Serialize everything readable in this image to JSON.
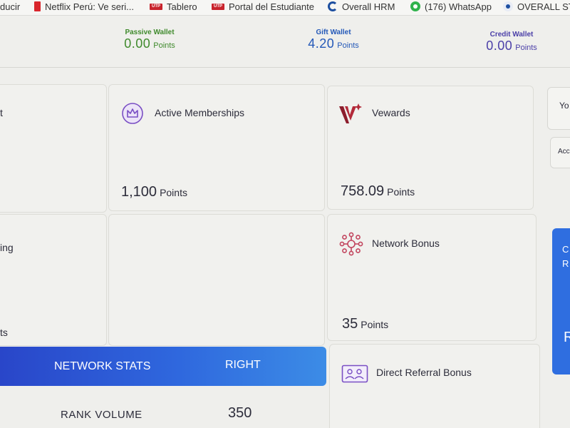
{
  "bookmarks": [
    {
      "label": "ducir",
      "icon": "none"
    },
    {
      "label": "Netflix Perú: Ve seri...",
      "icon": "netflix-icon"
    },
    {
      "label": "Tablero",
      "icon": "utp-icon"
    },
    {
      "label": "Portal del Estudiante",
      "icon": "utp-icon"
    },
    {
      "label": "Overall HRM",
      "icon": "hrm-icon"
    },
    {
      "label": "(176) WhatsApp",
      "icon": "whatsapp-icon"
    },
    {
      "label": "OVERALL STR",
      "icon": "overall-icon"
    }
  ],
  "utp_icon_text": "UTP",
  "wallets": {
    "passive": {
      "label": "Passive Wallet",
      "value": "0.00",
      "unit": "Points"
    },
    "gift": {
      "label": "Gift Wallet",
      "value": "4.20",
      "unit": "Points"
    },
    "credit": {
      "label": "Credit Wallet",
      "value": "0.00",
      "unit": "Points"
    }
  },
  "left_column": {
    "text1": "t",
    "text2": "ing",
    "text3": "ts"
  },
  "cards": {
    "active_memberships": {
      "title": "Active Memberships",
      "value": "1,100",
      "unit": "Points",
      "icon": "crown-icon"
    },
    "vewards": {
      "title": "Vewards",
      "value": "758.09",
      "unit": "Points",
      "icon": "vewards-logo-icon"
    },
    "network_bonus": {
      "title": "Network Bonus",
      "value": "35",
      "unit": "Points",
      "icon": "network-icon"
    },
    "direct_referral_bonus": {
      "title": "Direct Referral Bonus",
      "icon": "referral-card-icon"
    }
  },
  "network_stats": {
    "left_label": "NETWORK STATS",
    "right_label": "RIGHT"
  },
  "rank": {
    "label": "RANK VOLUME",
    "value": "350"
  },
  "right_edge": {
    "card1_text": "Yo",
    "card2_text": "Acc",
    "blue_text1": "C",
    "blue_text2": "R",
    "blue_text3": "R"
  },
  "colors": {
    "passive": "#3f8a2c",
    "gift": "#2358b8",
    "credit": "#4b3fa8",
    "accent_blue": "#2f68de",
    "crown_purple": "#7a4fc4",
    "network_pink": "#c2455e",
    "vewards_red": "#8c1d2c"
  }
}
